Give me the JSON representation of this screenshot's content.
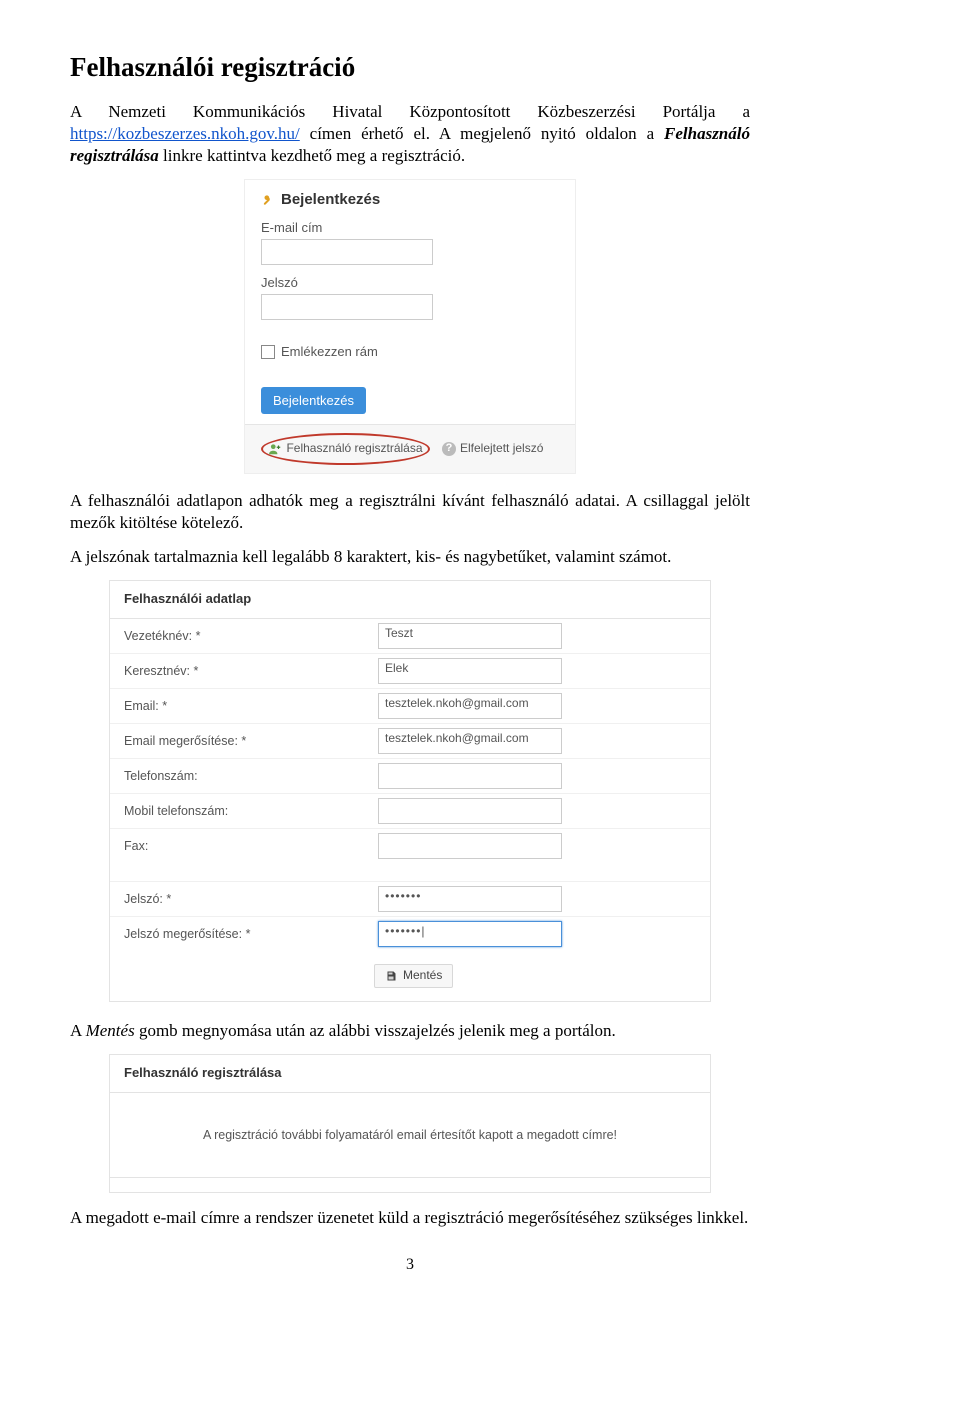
{
  "heading": "Felhasználói regisztráció",
  "intro1a": "A Nemzeti Kommunikációs Hivatal Központosított Közbeszerzési Portálja a ",
  "intro1link": "https://kozbeszerzes.nkoh.gov.hu/",
  "intro1b": " címen érhető el. A megjelenő nyitó oldalon a ",
  "intro1ital": "Felhasználó regisztrálása",
  "intro1c": " linkre kattintva kezdhető meg a regisztráció.",
  "login": {
    "title": "Bejelentkezés",
    "email_label": "E-mail cím",
    "pwd_label": "Jelszó",
    "remember": "Emlékezzen rám",
    "button": "Bejelentkezés",
    "reg_link": "Felhasználó regisztrálása",
    "forgot_link": "Elfelejtett jelszó"
  },
  "para2": "A felhasználói adatlapon adhatók meg a regisztrálni kívánt felhasználó adatai. A csillaggal jelölt mezők kitöltése kötelező.",
  "para3": "A jelszónak tartalmaznia kell legalább 8 karaktert, kis- és nagybetűket, valamint számot.",
  "form": {
    "head": "Felhasználói adatlap",
    "rows": [
      {
        "label": "Vezetéknév: *",
        "value": "Teszt"
      },
      {
        "label": "Keresztnév: *",
        "value": "Elek"
      },
      {
        "label": "Email: *",
        "value": "tesztelek.nkoh@gmail.com"
      },
      {
        "label": "Email megerősítése: *",
        "value": "tesztelek.nkoh@gmail.com"
      },
      {
        "label": "Telefonszám:",
        "value": ""
      },
      {
        "label": "Mobil telefonszám:",
        "value": ""
      },
      {
        "label": "Fax:",
        "value": ""
      }
    ],
    "pwd_rows": [
      {
        "label": "Jelszó: *",
        "value": "•••••••"
      },
      {
        "label": "Jelszó megerősítése: *",
        "value": "•••••••",
        "focus": true
      }
    ],
    "save": "Mentés"
  },
  "para4a": "A ",
  "para4ital": "Mentés",
  "para4b": " gomb megnyomása után az alábbi visszajelzés jelenik meg a portálon.",
  "conf": {
    "head": "Felhasználó regisztrálása",
    "body": "A regisztráció további folyamatáról email értesítőt kapott a megadott címre!"
  },
  "para5": "A megadott e-mail címre a rendszer üzenetet küld a regisztráció megerősítéséhez szükséges linkkel.",
  "pagenum": "3"
}
